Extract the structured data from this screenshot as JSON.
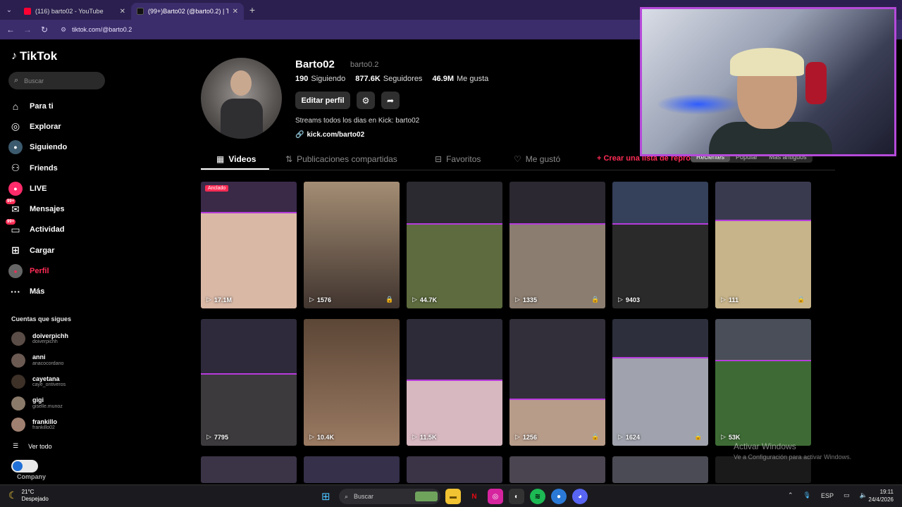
{
  "browser": {
    "tabs": [
      {
        "title": "(116) barto02 - YouTube",
        "color": "#ff0033"
      },
      {
        "title": "(99+)Barto02 (@barto0.2) | TikT",
        "color": "#111111"
      }
    ],
    "url": "tiktok.com/@barto0.2"
  },
  "sidebar": {
    "logo": "TikTok",
    "search_placeholder": "Buscar",
    "nav": [
      {
        "label": "Para ti",
        "icon": "home-icon"
      },
      {
        "label": "Explorar",
        "icon": "compass-icon"
      },
      {
        "label": "Siguiendo",
        "icon": "following-avatar-icon"
      },
      {
        "label": "Friends",
        "icon": "friends-icon"
      },
      {
        "label": "LIVE",
        "icon": "live-icon"
      },
      {
        "label": "Mensajes",
        "icon": "messages-icon",
        "badge": "99+"
      },
      {
        "label": "Actividad",
        "icon": "activity-icon",
        "badge": "99+"
      },
      {
        "label": "Cargar",
        "icon": "upload-icon"
      },
      {
        "label": "Perfil",
        "icon": "profile-icon",
        "active": true
      },
      {
        "label": "Más",
        "icon": "more-icon"
      }
    ],
    "following_title": "Cuentas que sigues",
    "following": [
      {
        "name": "doiverpichh",
        "handle": "doiverpichh"
      },
      {
        "name": "anni",
        "handle": "anacocordano"
      },
      {
        "name": "cayetana",
        "handle": "caye_ontiveros"
      },
      {
        "name": "gigi",
        "handle": "giselle.munoz"
      },
      {
        "name": "frankillo",
        "handle": "frankillo02"
      }
    ],
    "see_all": "Ver todo",
    "company": "Company"
  },
  "profile": {
    "name": "Barto02",
    "handle": "barto0.2",
    "following_count": "190",
    "following_label": "Siguiendo",
    "followers_count": "877.6K",
    "followers_label": "Seguidores",
    "likes_count": "46.9M",
    "likes_label": "Me gusta",
    "edit_button": "Editar perfil",
    "bio": "Streams todos los dias en Kick: barto02",
    "link": "kick.com/barto02"
  },
  "tabs": {
    "videos": "Videos",
    "shared": "Publicaciones compartidas",
    "favorites": "Favoritos",
    "liked": "Me gustó",
    "create_list": "+ Crear una lista de reprod",
    "sort": [
      "Recientes",
      "Popular",
      "Más antiguos"
    ]
  },
  "videos": [
    {
      "views": "17.1M",
      "pinned_label": "Anclado",
      "top": "#3a2a48",
      "bottom": "#d9b8a6",
      "split": 0.24
    },
    {
      "views": "1576",
      "lock": true,
      "top": "#a48d74",
      "bottom": "#41352f",
      "split": 0
    },
    {
      "views": "44.7K",
      "top": "#2b2a30",
      "bottom": "#5d6b3e",
      "split": 0.33
    },
    {
      "views": "1335",
      "lock": true,
      "top": "#2b2831",
      "bottom": "#8b7d6f",
      "split": 0.33
    },
    {
      "views": "9403",
      "top": "#35405a",
      "bottom": "#2a2a2a",
      "split": 0.33
    },
    {
      "views": "111",
      "lock": true,
      "top": "#3a3a4f",
      "bottom": "#c7b48a",
      "split": 0.3
    },
    {
      "views": "7795",
      "top": "#2e2a3b",
      "bottom": "#3c3a3c",
      "split": 0.43
    },
    {
      "views": "10.4K",
      "top": "#5c4636",
      "bottom": "#9a7a62",
      "split": 0
    },
    {
      "views": "11.5K",
      "top": "#2e2b38",
      "bottom": "#d8b8c0",
      "split": 0.48
    },
    {
      "views": "1256",
      "lock": true,
      "top": "#322f3a",
      "bottom": "#b89c8a",
      "split": 0.63
    },
    {
      "views": "1624",
      "lock": true,
      "top": "#2d2f3c",
      "bottom": "#a0a3ad",
      "split": 0.3
    },
    {
      "views": "53K",
      "top": "#4a4e58",
      "bottom": "#3e6b35",
      "split": 0.32
    },
    {
      "top": "#3b3346"
    },
    {
      "top": "#36304a"
    },
    {
      "top": "#3b3346"
    },
    {
      "top": "#4a4550"
    },
    {
      "top": "#4b4b55"
    },
    {
      "top": "#1a1a1a"
    }
  ],
  "watermark": {
    "title": "Activar Windows",
    "subtitle": "Ve a Configuración para activar Windows."
  },
  "taskbar": {
    "temp": "21°C",
    "weather": "Despejado",
    "search_placeholder": "Buscar",
    "lang": "ESP",
    "time": "19:11",
    "date": "24/4/2026"
  }
}
